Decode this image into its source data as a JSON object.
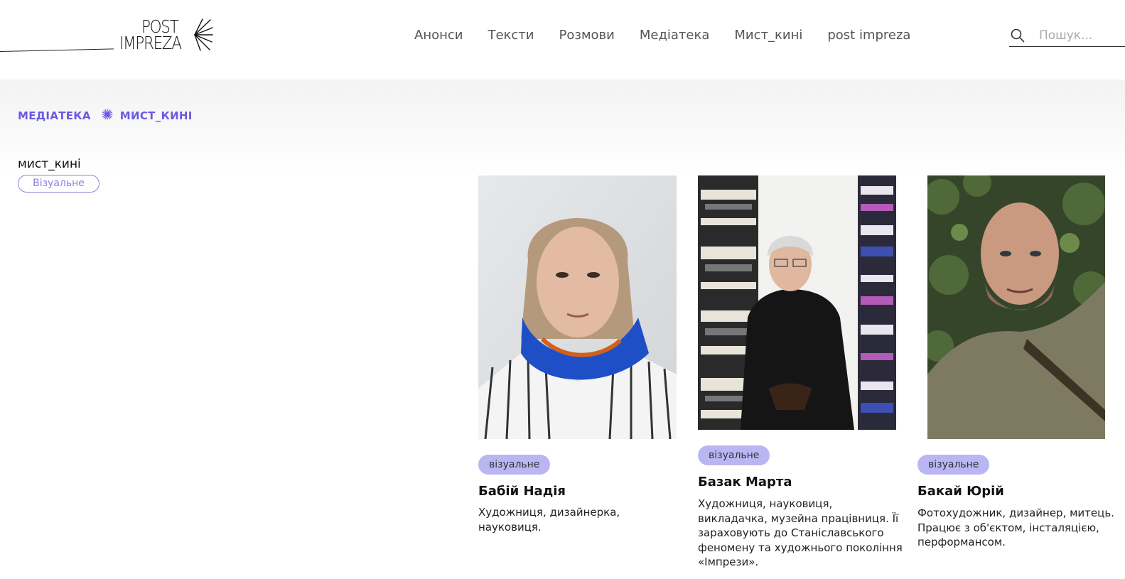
{
  "header": {
    "logo": {
      "line1": "POST",
      "line2": "IMPREZA"
    },
    "nav": [
      "Анонси",
      "Тексти",
      "Розмови",
      "Медіатека",
      "Мист_кині",
      "post impreza"
    ],
    "search": {
      "placeholder": "Пошук..."
    }
  },
  "breadcrumb": {
    "items": [
      "МЕДІАТЕКА",
      "МИСТ_КИНІ"
    ]
  },
  "page": {
    "title": "мист_кині",
    "filter_tag": "Візуальне"
  },
  "cards": [
    {
      "badge": "візуальне",
      "name": "Бабій Надія",
      "description": "Художниця, дизайнерка, науковиця."
    },
    {
      "badge": "візуальне",
      "name": "Базак Марта",
      "description": "Художниця, науковиця, викладачка, музейна працівниця. Її зараховують до Станіславського феномену та художнього покоління «Імпрези»."
    },
    {
      "badge": "візуальне",
      "name": "Бакай Юрій",
      "description": "Фотохудожник, дизайнер, митець. Працює з об'єктом, інсталяцією, перформансом."
    }
  ],
  "colors": {
    "accent": "#6a5ae0",
    "badge_bg": "#b9b6f3",
    "chip_border": "#8a7fe0"
  }
}
